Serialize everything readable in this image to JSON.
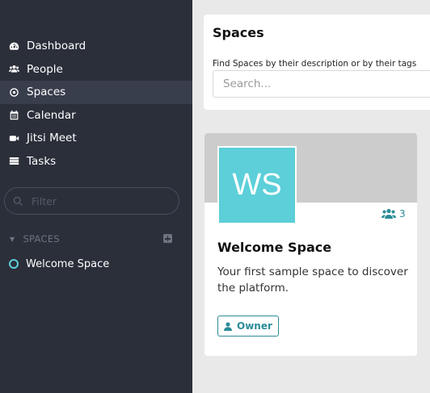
{
  "sidebar": {
    "nav": [
      {
        "label": "Dashboard",
        "icon": "dashboard-icon"
      },
      {
        "label": "People",
        "icon": "people-icon"
      },
      {
        "label": "Spaces",
        "icon": "spaces-icon",
        "active": true
      },
      {
        "label": "Calendar",
        "icon": "calendar-icon"
      },
      {
        "label": "Jitsi Meet",
        "icon": "video-icon"
      },
      {
        "label": "Tasks",
        "icon": "tasks-icon"
      }
    ],
    "filter_placeholder": "Filter",
    "spaces_header": "SPACES",
    "spaces": [
      {
        "label": "Welcome Space"
      }
    ]
  },
  "main": {
    "title": "Spaces",
    "search_label": "Find Spaces by their description or by their tags",
    "search_placeholder": "Search...",
    "card": {
      "initials": "WS",
      "members": "3",
      "title": "Welcome Space",
      "description": "Your first sample space to discover the platform.",
      "role": "Owner"
    }
  },
  "colors": {
    "sidebar_bg": "#2b2f3a",
    "sidebar_active": "#393e4c",
    "accent": "#5ccfd9",
    "accent_dark": "#2b8c98",
    "banner": "#cccccc",
    "page_bg": "#e9e9e9"
  }
}
